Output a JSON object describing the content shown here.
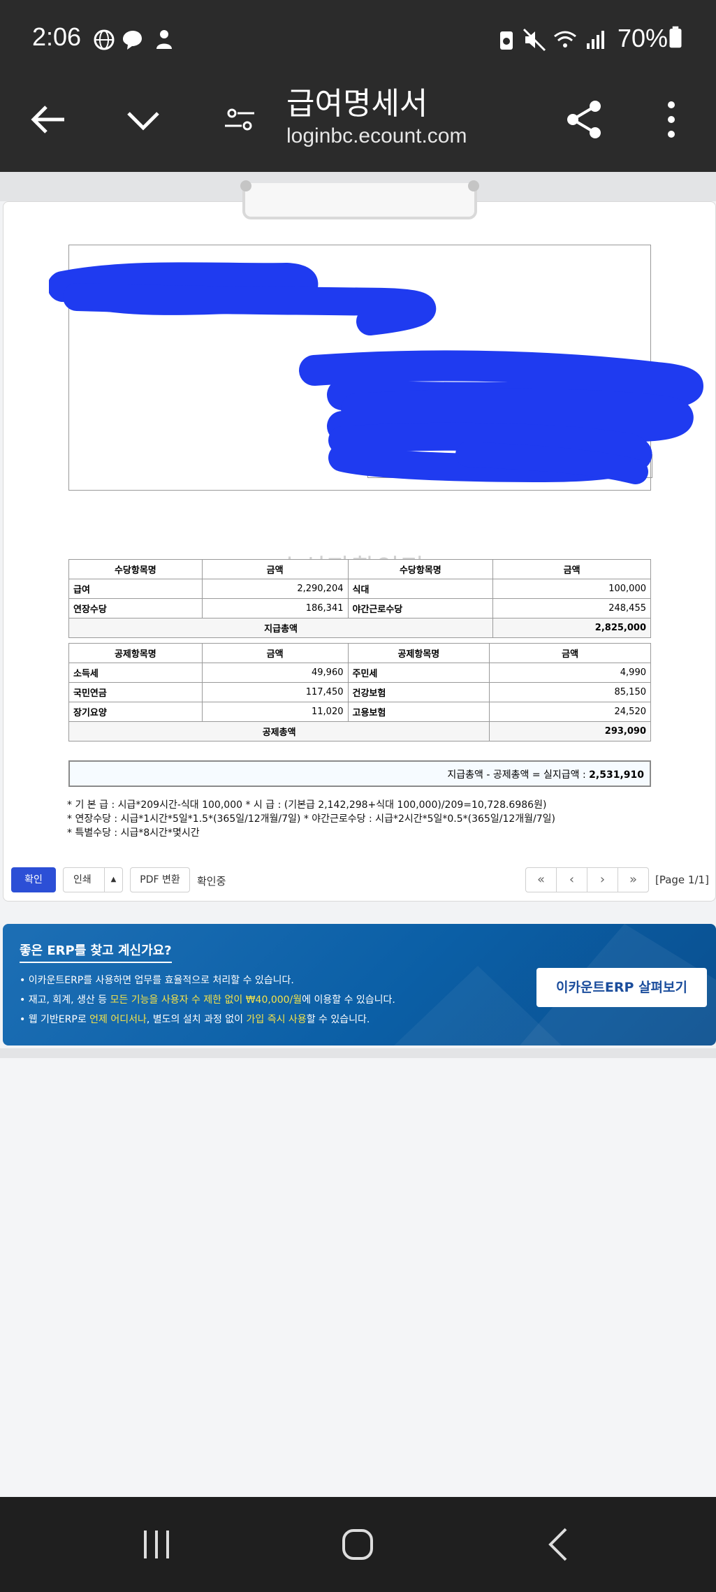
{
  "status_bar": {
    "time": "2:06",
    "battery_percent": "70%",
    "icons": [
      "globe-icon",
      "chat-bubble-icon",
      "person-icon",
      "battery-saver-icon",
      "mute-icon",
      "wifi-icon",
      "signal-icon",
      "battery-icon"
    ]
  },
  "app_bar": {
    "title": "급여명세서",
    "url": "loginbc.ecount.com"
  },
  "watermark": "수신자확인전",
  "allowance_table": {
    "headers": [
      "수당항목명",
      "금액",
      "수당항목명",
      "금액"
    ],
    "rows": [
      {
        "name1": "급여",
        "amount1": "2,290,204",
        "name2": "식대",
        "amount2": "100,000"
      },
      {
        "name1": "연장수당",
        "amount1": "186,341",
        "name2": "야간근로수당",
        "amount2": "248,455"
      }
    ],
    "total_label": "지급총액",
    "total_value": "2,825,000"
  },
  "deduction_table": {
    "headers": [
      "공제항목명",
      "금액",
      "공제항목명",
      "금액"
    ],
    "rows": [
      {
        "name1": "소득세",
        "amount1": "49,960",
        "name2": "주민세",
        "amount2": "4,990"
      },
      {
        "name1": "국민연금",
        "amount1": "117,450",
        "name2": "건강보험",
        "amount2": "85,150"
      },
      {
        "name1": "장기요양",
        "amount1": "11,020",
        "name2": "고용보험",
        "amount2": "24,520"
      }
    ],
    "total_label": "공제총액",
    "total_value": "293,090"
  },
  "net_pay": {
    "label": "지급총액 - 공제총액 = 실지급액 :",
    "value": "2,531,910"
  },
  "notes": [
    "* 기 본 급 : 시급*209시간-식대 100,000   * 시 급 : (기본급 2,142,298+식대 100,000)/209=10,728.6986원)",
    "* 연장수당 : 시급*1시간*5일*1.5*(365일/12개월/7일)    * 야간근로수당 : 시급*2시간*5일*0.5*(365일/12개월/7일)",
    "* 특별수당 : 시급*8시간*몇시간"
  ],
  "controls": {
    "confirm": "확인",
    "print": "인쇄",
    "print_dropdown": "▲",
    "pdf": "PDF 변환",
    "status": "확인중",
    "first": "«",
    "prev": "‹",
    "next": "›",
    "last": "»",
    "page_indicator": "[Page 1/1]"
  },
  "banner": {
    "title": "좋은 ERP를 찾고 계신가요?",
    "line1": "• 이카운트ERP를 사용하면 업무를 효율적으로 처리할 수 있습니다.",
    "line2_a": "• 재고, 회계, 생산 등 ",
    "line2_hl": "모든 기능을 사용자 수 제한 없이 ₩40,000/월",
    "line2_b": "에 이용할 수 있습니다.",
    "line3_a": "• 웹 기반ERP로 ",
    "line3_hl1": "언제 어디서나",
    "line3_b": ", 별도의 설치 과정 없이 ",
    "line3_hl2": "가입 즉시 사용",
    "line3_c": "할 수 있습니다.",
    "button": "이카운트ERP 살펴보기"
  },
  "colors": {
    "bars": "#2b2b2b",
    "confirm_button": "#2c4fd6",
    "banner": "#0b5fa6",
    "highlight": "#f5e34a",
    "redaction": "#1f3bf0"
  }
}
